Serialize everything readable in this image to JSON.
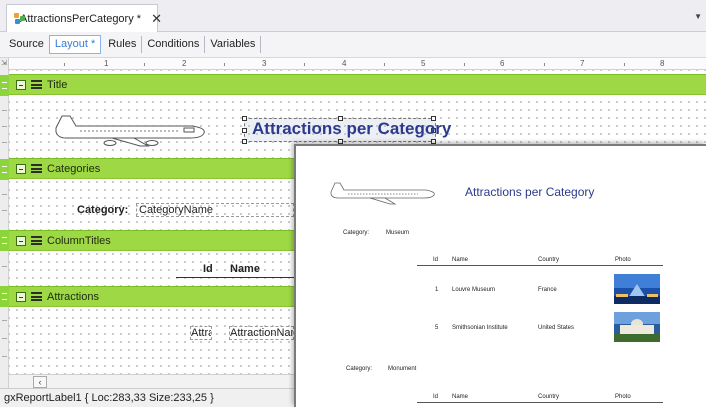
{
  "tabs": [
    {
      "label": "AttractionsPerCategory *",
      "close": "✕"
    }
  ],
  "subtabs": [
    "Source",
    "Layout *",
    "Rules",
    "Conditions",
    "Variables"
  ],
  "ruler": {
    "marks": [
      "1",
      "2",
      "3",
      "4",
      "5",
      "6",
      "7",
      "8"
    ]
  },
  "bands": {
    "title": "Title",
    "categories": "Categories",
    "column_titles": "ColumnTitles",
    "attractions": "Attractions"
  },
  "designer": {
    "report_title": "Attractions per Category",
    "category_label": "Category:",
    "category_value": "CategoryName",
    "col_id": "Id",
    "col_name": "Name",
    "attr_id": "Attra",
    "attr_name": "AttractionName"
  },
  "preview": {
    "title": "Attractions per Category",
    "groups": [
      {
        "category_label": "Category:",
        "category": "Museum",
        "headers": [
          "Id",
          "Name",
          "Country",
          "Photo"
        ],
        "rows": [
          {
            "id": "1",
            "name": "Louvre Museum",
            "country": "France"
          },
          {
            "id": "5",
            "name": "Smithsonian Institute",
            "country": "United States"
          }
        ]
      },
      {
        "category_label": "Category:",
        "category": "Monument",
        "headers": [
          "Id",
          "Name",
          "Country",
          "Photo"
        ],
        "rows": []
      }
    ]
  },
  "status": "gxReportLabel1 { Loc:283,33 Size:233,25 }",
  "colors": {
    "band_green": "#9ed945",
    "title_blue": "#2b3a8e",
    "active_tab": "#3a7bd5"
  }
}
